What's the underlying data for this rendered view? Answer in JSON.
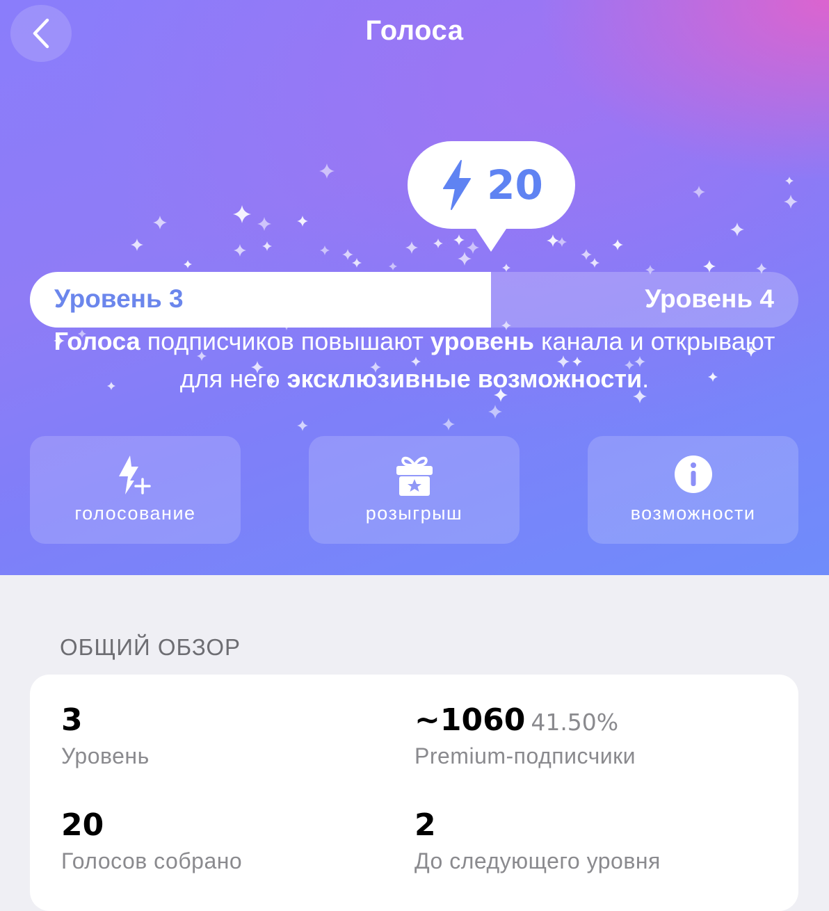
{
  "header": {
    "title": "Голоса",
    "back_icon": "chevron-left-icon"
  },
  "boosts": {
    "count": "20",
    "icon": "lightning-icon"
  },
  "progress": {
    "current_level_label": "Уровень 3",
    "next_level_label": "Уровень 4",
    "fraction": 0.6
  },
  "description": {
    "part1_bold": "Голоса",
    "part2": " подписчиков повышают ",
    "part3_bold": "уровень",
    "part4": " канала и открывают для него ",
    "part5_bold": "эксклюзивные возможности",
    "part6": "."
  },
  "actions": [
    {
      "label": "голосование",
      "icon": "boost-plus-icon"
    },
    {
      "label": "розыгрыш",
      "icon": "gift-icon"
    },
    {
      "label": "возможности",
      "icon": "info-icon"
    }
  ],
  "overview": {
    "title": "ОБЩИЙ ОБЗОР",
    "level": {
      "value": "3",
      "label": "Уровень"
    },
    "premium": {
      "value": "~1060",
      "percent": "41.50%",
      "label": "Premium-подписчики"
    },
    "votes": {
      "value": "20",
      "label": "Голосов собрано"
    },
    "next": {
      "value": "2",
      "label": "До следующего уровня"
    }
  },
  "colors": {
    "accent": "#5f83f2",
    "hero_gradient_start": "#8a7dfb",
    "hero_gradient_end": "#6f8cfa",
    "hero_corner_pink": "#e860c8"
  }
}
